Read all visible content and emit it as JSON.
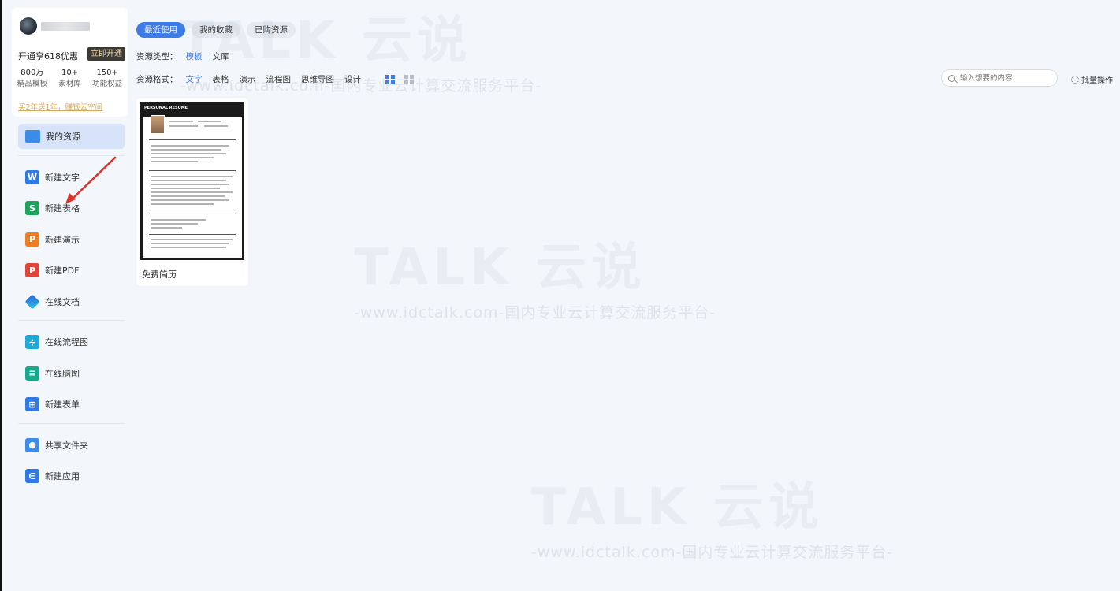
{
  "vip": {
    "promo_text": "开通享618优惠",
    "promo_button": "立即开通",
    "stats": [
      {
        "num": "800万",
        "label": "精品模板"
      },
      {
        "num": "10+",
        "label": "素材库"
      },
      {
        "num": "150+",
        "label": "功能权益"
      }
    ],
    "link": "买2年送1年，赚钱云空间"
  },
  "nav": {
    "my_resources": "我的资源",
    "new_doc": "新建文字",
    "new_sheet": "新建表格",
    "new_slides": "新建演示",
    "new_pdf": "新建PDF",
    "online_doc": "在线文档",
    "online_flowchart": "在线流程图",
    "online_mindmap": "在线脑图",
    "new_form": "新建表单",
    "shared_folder": "共享文件夹",
    "new_app": "新建应用"
  },
  "tabs": [
    "最近使用",
    "我的收藏",
    "已购资源"
  ],
  "filters": {
    "type_label": "资源类型：",
    "types": [
      "模板",
      "文库"
    ],
    "format_label": "资源格式：",
    "formats": [
      "文字",
      "表格",
      "演示",
      "流程图",
      "思维导图",
      "设计"
    ]
  },
  "search": {
    "placeholder": "输入想要的内容"
  },
  "batch_label": "批量操作",
  "card": {
    "title": "免费简历",
    "thumb_title": "PERSONAL RESUME"
  },
  "watermark": {
    "logo": "TALK 云说",
    "sub": "-www.idctalk.com-国内专业云计算交流服务平台-"
  },
  "colors": {
    "accent": "#3d7be6",
    "arrow": "#e0302a"
  }
}
